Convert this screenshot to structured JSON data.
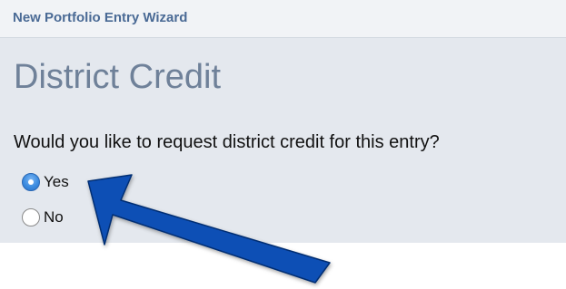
{
  "wizard": {
    "title": "New Portfolio Entry Wizard"
  },
  "section": {
    "heading": "District Credit",
    "question": "Would you like to request district credit for this entry?"
  },
  "options": [
    {
      "label": "Yes",
      "selected": true
    },
    {
      "label": "No",
      "selected": false
    }
  ],
  "annotation": {
    "icon": "arrow-icon",
    "color": "#0b4fb5",
    "target": "Yes"
  }
}
